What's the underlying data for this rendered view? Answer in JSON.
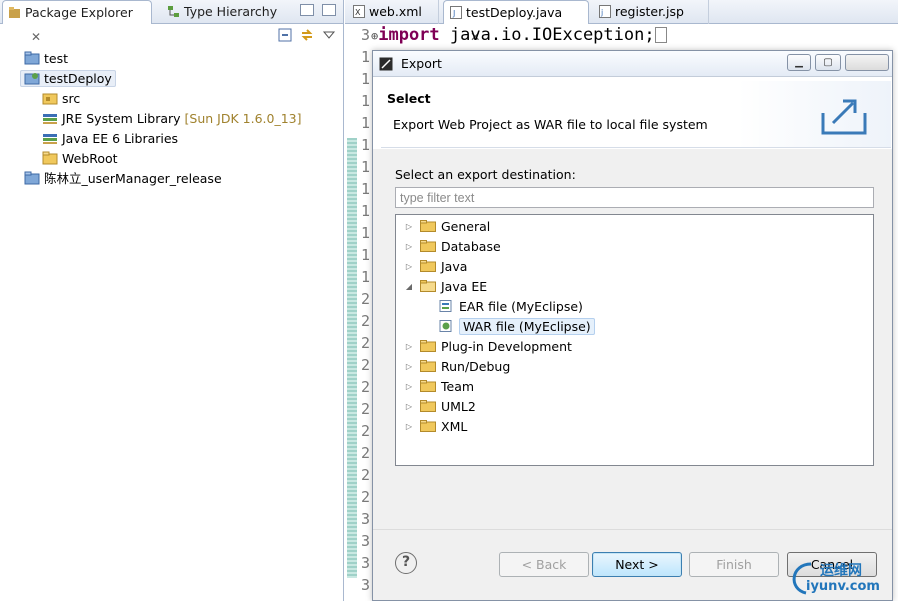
{
  "left_panel": {
    "tabs": [
      {
        "label": "Package Explorer",
        "close": "✕"
      },
      {
        "label": "Type Hierarchy"
      }
    ],
    "tree": [
      {
        "label": "test",
        "icon": "project-folder-icon"
      },
      {
        "label": "testDeploy",
        "icon": "web-project-icon"
      },
      {
        "label": "src",
        "icon": "source-folder-icon"
      },
      {
        "label": "JRE System Library",
        "suffix": "[Sun JDK 1.6.0_13]",
        "icon": "library-icon"
      },
      {
        "label": "Java EE 6 Libraries",
        "icon": "library-icon"
      },
      {
        "label": "WebRoot",
        "icon": "folder-icon"
      },
      {
        "label": "陈林立_userManager_release",
        "icon": "project-folder-icon"
      }
    ]
  },
  "editor": {
    "tabs": [
      {
        "label": "web.xml",
        "close": ""
      },
      {
        "label": "testDeploy.java",
        "close": "✕"
      },
      {
        "label": "register.jsp",
        "close": ""
      }
    ],
    "first_line_no": "3",
    "fold_marker": "⊕",
    "code_keyword": "import",
    "code_rest": " java.io.IOException;",
    "line_numbers": [
      "1",
      "1",
      "1",
      "1",
      "1",
      "1",
      "1",
      "1",
      "1",
      "1",
      "1",
      "2",
      "2",
      "2",
      "2",
      "2",
      "2",
      "2",
      "2",
      "2",
      "2",
      "3",
      "3",
      "3",
      "3",
      "3"
    ]
  },
  "dialog": {
    "title": "Export",
    "banner_title": "Select",
    "banner_desc": "Export Web Project as WAR file to local file system",
    "dest_label": "Select an export destination:",
    "filter_placeholder": "type filter text",
    "tree": [
      {
        "label": "General",
        "expanded": false
      },
      {
        "label": "Database",
        "expanded": false
      },
      {
        "label": "Java",
        "expanded": false
      },
      {
        "label": "Java EE",
        "expanded": true
      },
      {
        "label": "EAR file (MyEclipse)",
        "child": true
      },
      {
        "label": "WAR file (MyEclipse)",
        "child": true,
        "selected": true
      },
      {
        "label": "Plug-in Development",
        "expanded": false
      },
      {
        "label": "Run/Debug",
        "expanded": false
      },
      {
        "label": "Team",
        "expanded": false
      },
      {
        "label": "UML2",
        "expanded": false
      },
      {
        "label": "XML",
        "expanded": false
      }
    ],
    "buttons": {
      "help": "?",
      "back": "< Back",
      "next": "Next >",
      "finish": "Finish",
      "cancel": "Cancel"
    }
  },
  "watermark": {
    "cn": "运维网",
    "url": "iyunv.com"
  }
}
